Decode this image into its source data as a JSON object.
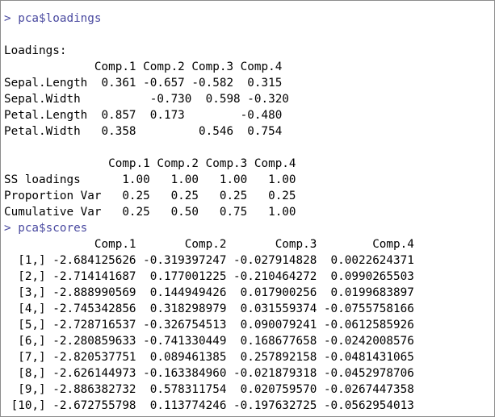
{
  "colors": {
    "background": "#ffffff",
    "output_text": "#000000",
    "command_text": "#4a4aa0",
    "border": "#8c8c8c"
  },
  "lines": [
    {
      "type": "cmd",
      "text": "> pca$loadings"
    },
    {
      "type": "out",
      "text": ""
    },
    {
      "type": "out",
      "text": "Loadings:"
    },
    {
      "type": "out",
      "text": "             Comp.1 Comp.2 Comp.3 Comp.4"
    },
    {
      "type": "out",
      "text": "Sepal.Length  0.361 -0.657 -0.582  0.315"
    },
    {
      "type": "out",
      "text": "Sepal.Width          -0.730  0.598 -0.320"
    },
    {
      "type": "out",
      "text": "Petal.Length  0.857  0.173        -0.480"
    },
    {
      "type": "out",
      "text": "Petal.Width   0.358         0.546  0.754"
    },
    {
      "type": "out",
      "text": ""
    },
    {
      "type": "out",
      "text": "               Comp.1 Comp.2 Comp.3 Comp.4"
    },
    {
      "type": "out",
      "text": "SS loadings      1.00   1.00   1.00   1.00"
    },
    {
      "type": "out",
      "text": "Proportion Var   0.25   0.25   0.25   0.25"
    },
    {
      "type": "out",
      "text": "Cumulative Var   0.25   0.50   0.75   1.00"
    },
    {
      "type": "cmd",
      "text": "> pca$scores"
    },
    {
      "type": "out",
      "text": "             Comp.1       Comp.2       Comp.3        Comp.4"
    },
    {
      "type": "out",
      "text": "  [1,] -2.684125626 -0.319397247 -0.027914828  0.0022624371"
    },
    {
      "type": "out",
      "text": "  [2,] -2.714141687  0.177001225 -0.210464272  0.0990265503"
    },
    {
      "type": "out",
      "text": "  [3,] -2.888990569  0.144949426  0.017900256  0.0199683897"
    },
    {
      "type": "out",
      "text": "  [4,] -2.745342856  0.318298979  0.031559374 -0.0755758166"
    },
    {
      "type": "out",
      "text": "  [5,] -2.728716537 -0.326754513  0.090079241 -0.0612585926"
    },
    {
      "type": "out",
      "text": "  [6,] -2.280859633 -0.741330449  0.168677658 -0.0242008576"
    },
    {
      "type": "out",
      "text": "  [7,] -2.820537751  0.089461385  0.257892158 -0.0481431065"
    },
    {
      "type": "out",
      "text": "  [8,] -2.626144973 -0.163384960 -0.021879318 -0.0452978706"
    },
    {
      "type": "out",
      "text": "  [9,] -2.886382732  0.578311754  0.020759570 -0.0267447358"
    },
    {
      "type": "out",
      "text": " [10,] -2.672755798  0.113774246 -0.197632725 -0.0562954013"
    }
  ]
}
